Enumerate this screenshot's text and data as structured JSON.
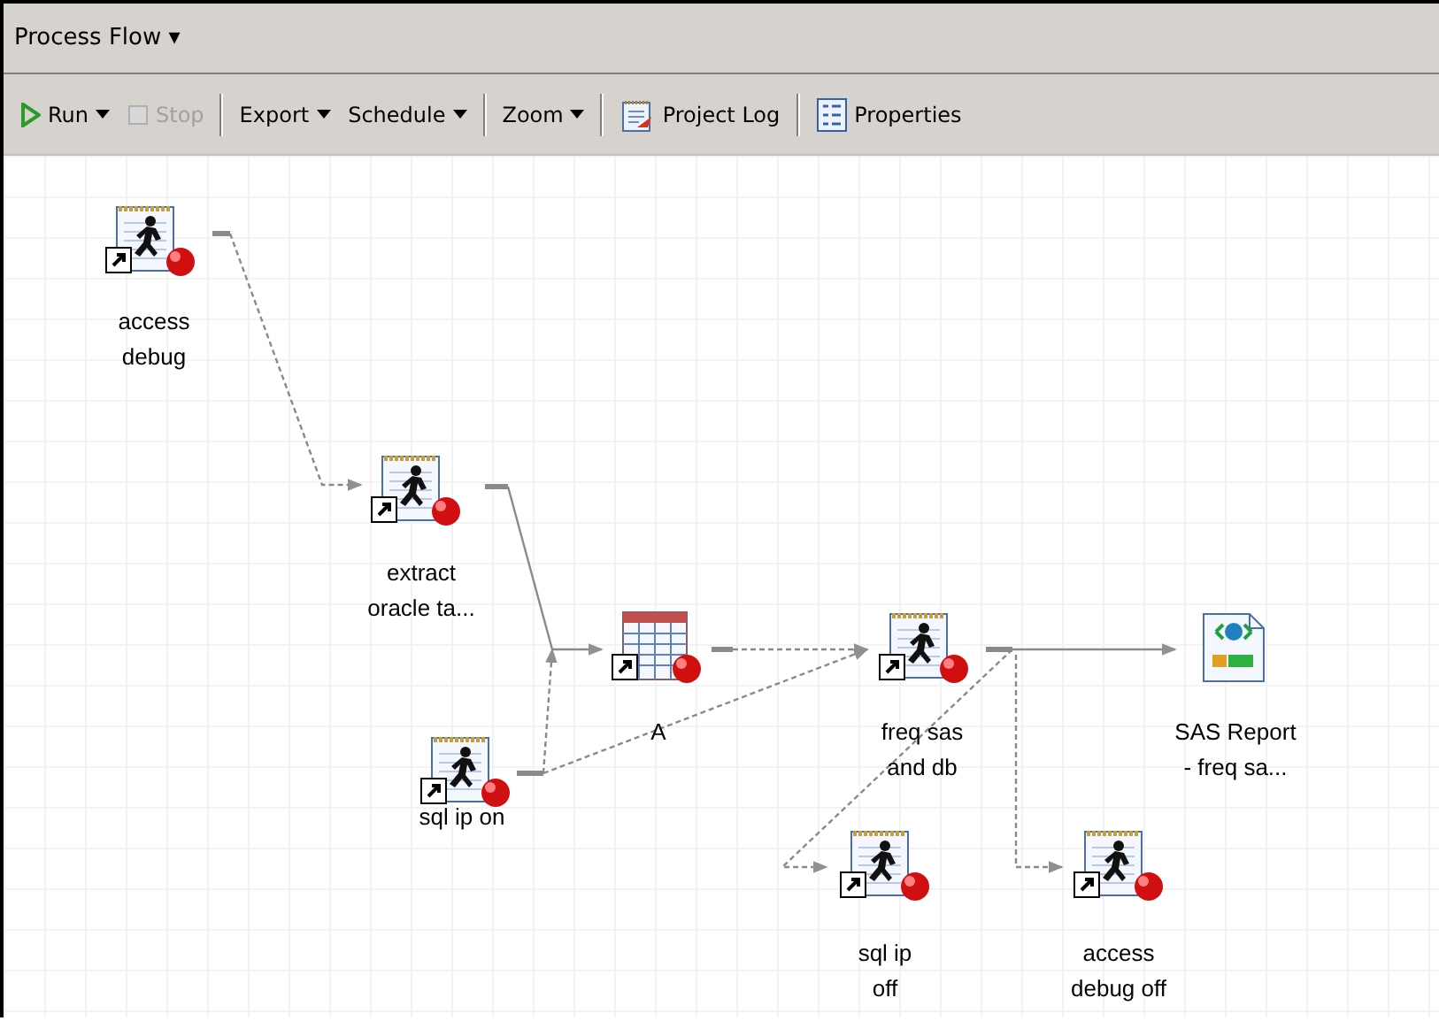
{
  "panel": {
    "title": "Process Flow",
    "menu_caret": "▾"
  },
  "toolbar": [
    {
      "kind": "button",
      "label": "Run",
      "dropdown": true,
      "disabled": false
    },
    {
      "kind": "button",
      "label": "Stop",
      "dropdown": false,
      "disabled": true
    },
    {
      "kind": "separator"
    },
    {
      "kind": "button",
      "label": "Export",
      "dropdown": true,
      "disabled": false
    },
    {
      "kind": "button",
      "label": "Schedule",
      "dropdown": true,
      "disabled": false
    },
    {
      "kind": "separator"
    },
    {
      "kind": "button",
      "label": "Zoom",
      "dropdown": true,
      "disabled": false
    },
    {
      "kind": "separator"
    },
    {
      "kind": "button",
      "label": "Project Log",
      "dropdown": false,
      "disabled": false
    },
    {
      "kind": "separator"
    },
    {
      "kind": "button",
      "label": "Properties",
      "dropdown": false,
      "disabled": false
    }
  ],
  "nodes": [
    {
      "kind": "program",
      "label_lines": [
        "access",
        "debug"
      ]
    },
    {
      "kind": "program",
      "label_lines": [
        "extract",
        "oracle ta..."
      ]
    },
    {
      "kind": "table",
      "label_lines": [
        "A"
      ]
    },
    {
      "kind": "program",
      "label_lines": [
        "sql ip on"
      ]
    },
    {
      "kind": "program",
      "label_lines": [
        "freq sas",
        "and db"
      ]
    },
    {
      "kind": "report",
      "label_lines": [
        "SAS Report",
        "- freq sa..."
      ]
    },
    {
      "kind": "program",
      "label_lines": [
        "sql ip",
        "off"
      ]
    },
    {
      "kind": "program",
      "label_lines": [
        "access",
        "debug off"
      ]
    }
  ]
}
